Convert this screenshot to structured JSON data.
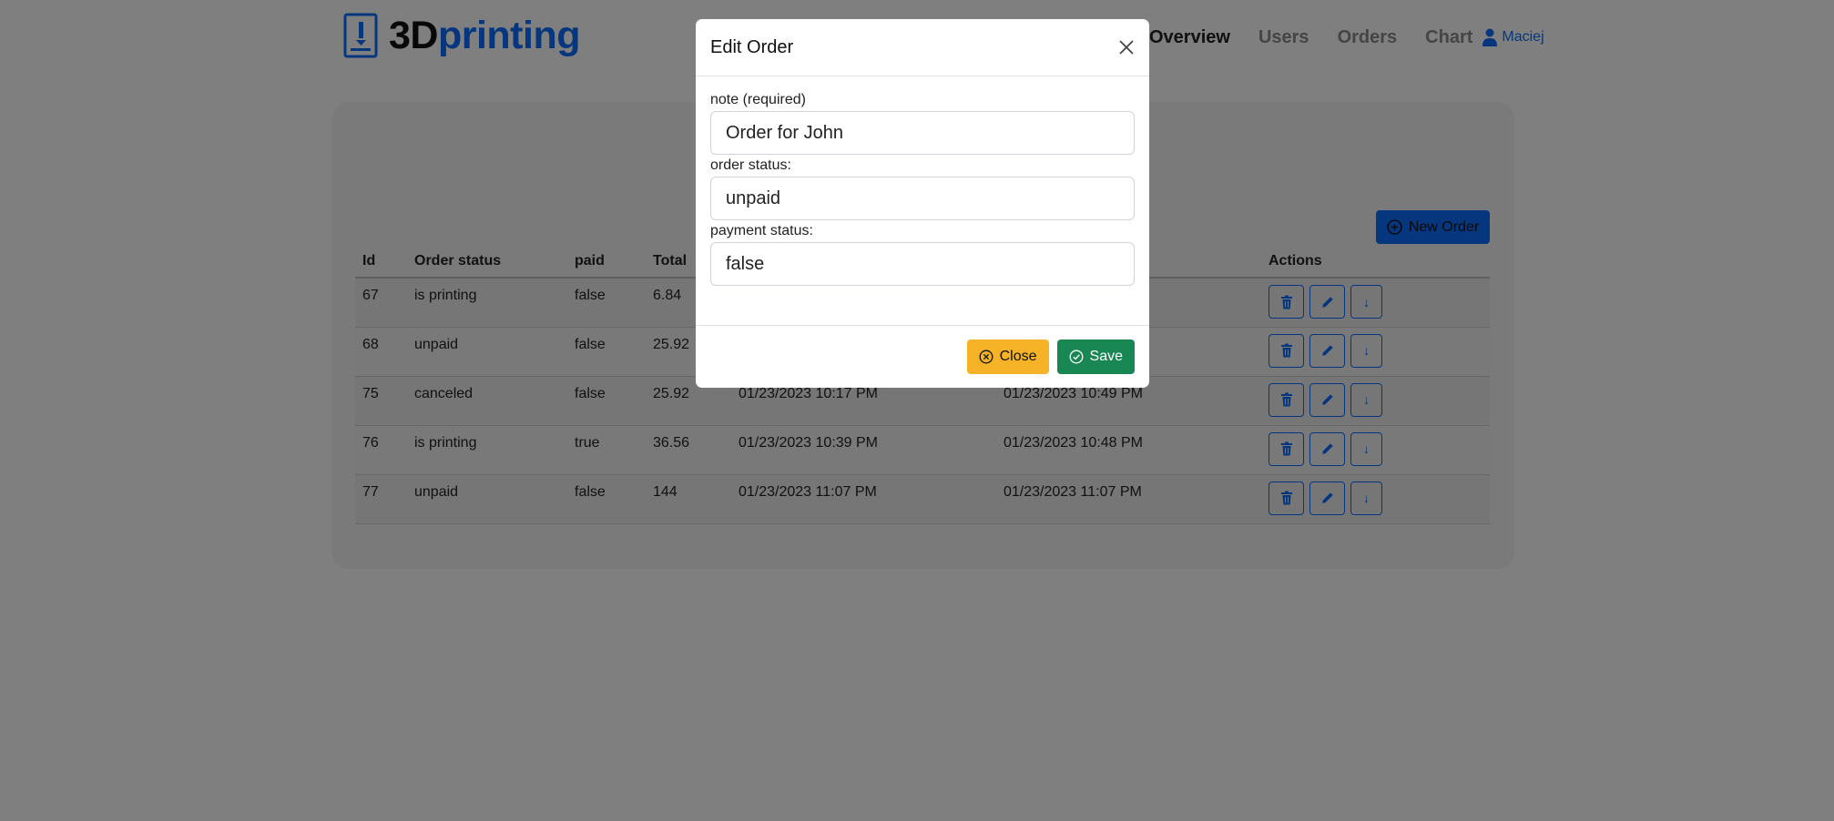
{
  "brand": {
    "logo_prefix": "3D",
    "logo_suffix": "printing"
  },
  "nav": {
    "items": [
      {
        "label": "Overview",
        "active": true
      },
      {
        "label": "Users",
        "active": false
      },
      {
        "label": "Orders",
        "active": false
      },
      {
        "label": "Chart",
        "active": false
      }
    ],
    "user": "Maciej"
  },
  "toolbar": {
    "new_order_label": "New Order"
  },
  "table": {
    "columns": [
      "Id",
      "Order status",
      "paid",
      "Total",
      "",
      "",
      "Actions"
    ],
    "rows": [
      {
        "id": "67",
        "status": "is printing",
        "paid": "false",
        "total": "6.84",
        "created": "",
        "updated": ""
      },
      {
        "id": "68",
        "status": "unpaid",
        "paid": "false",
        "total": "25.92",
        "created": "",
        "updated": ""
      },
      {
        "id": "75",
        "status": "canceled",
        "paid": "false",
        "total": "25.92",
        "created": "01/23/2023 10:17 PM",
        "updated": "01/23/2023 10:49 PM"
      },
      {
        "id": "76",
        "status": "is printing",
        "paid": "true",
        "total": "36.56",
        "created": "01/23/2023 10:39 PM",
        "updated": "01/23/2023 10:48 PM"
      },
      {
        "id": "77",
        "status": "unpaid",
        "paid": "false",
        "total": "144",
        "created": "01/23/2023 11:07 PM",
        "updated": "01/23/2023 11:07 PM"
      }
    ],
    "row_actions": [
      "trash-icon",
      "pencil-icon",
      "download-arrow-icon"
    ]
  },
  "modal": {
    "title": "Edit Order",
    "fields": {
      "note": {
        "label": "note (required)",
        "value": "Order for John"
      },
      "order_status": {
        "label": "order status:",
        "value": "unpaid"
      },
      "payment_status": {
        "label": "payment status:",
        "value": "false"
      }
    },
    "close_label": "Close",
    "save_label": "Save"
  },
  "colors": {
    "primary": "#0d6efd",
    "warning": "#f6b328",
    "success": "#198754",
    "overlay": "rgba(0,0,0,0.5)"
  }
}
